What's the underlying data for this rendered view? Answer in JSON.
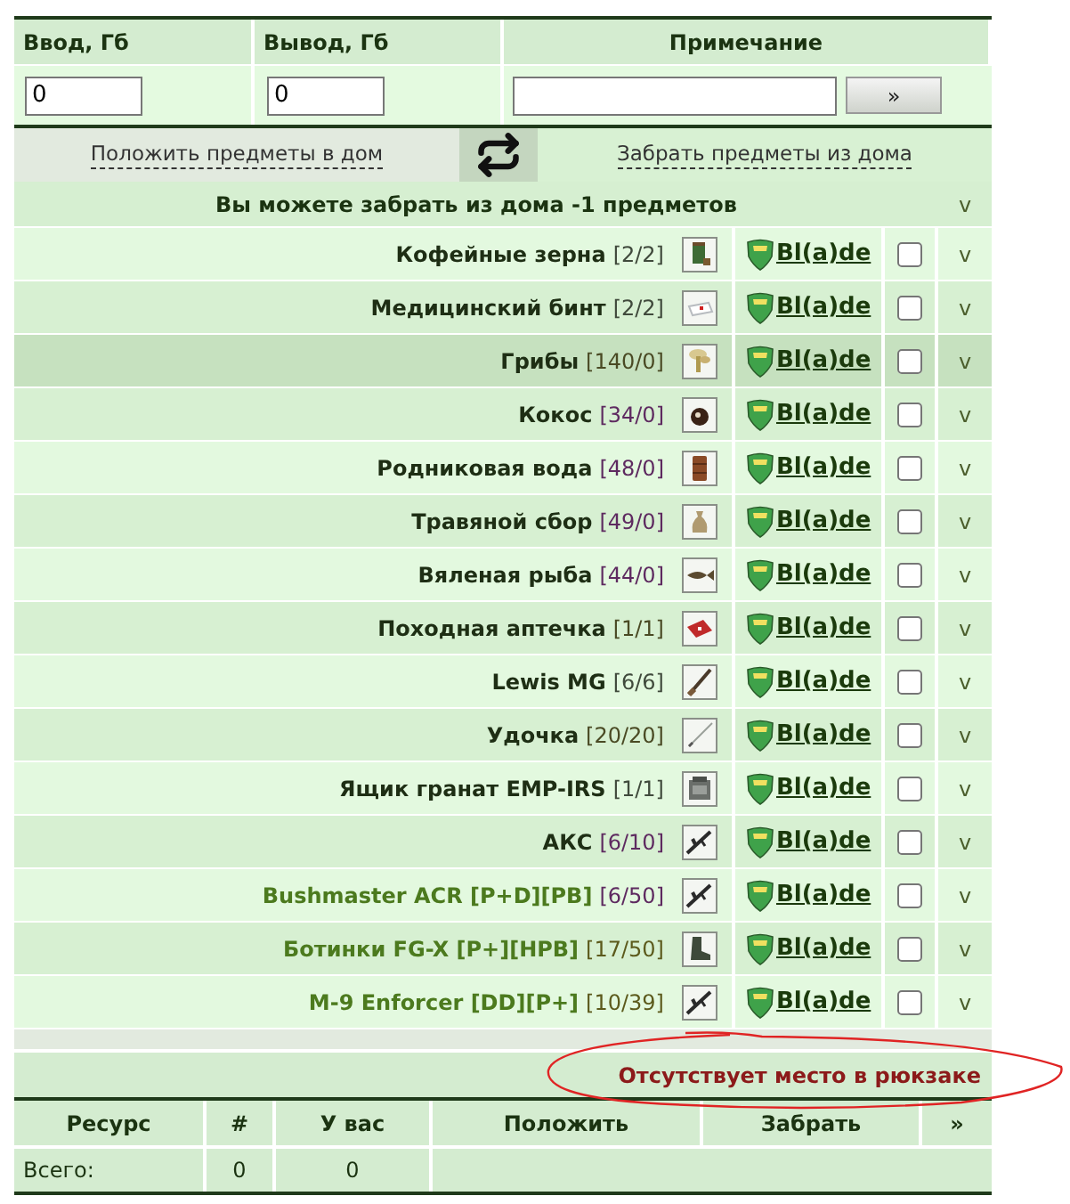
{
  "transfer_form": {
    "columns": [
      "Ввод, Гб",
      "Вывод, Гб",
      "Примечание"
    ],
    "input_value": "0",
    "output_value": "0",
    "submit_label": "»"
  },
  "mode_tabs": [
    {
      "label": "Положить предметы в дом",
      "selected": false
    },
    {
      "label": "Забрать предметы из дома",
      "selected": true
    }
  ],
  "items_header": {
    "title": "Вы можете забрать из дома -1 предметов",
    "toggle": "v"
  },
  "items": [
    {
      "name": {
        "text": "Кофейные зерна",
        "color": "#1e2e14"
      },
      "count": {
        "text": "[2/2]",
        "color": "#404a3c"
      },
      "kind": "jar",
      "owner": "Bl(a)de",
      "checked": false,
      "highlighted": false,
      "toggle": "v"
    },
    {
      "name": {
        "text": "Медицинский бинт",
        "color": "#1e2e14"
      },
      "count": {
        "text": "[2/2]",
        "color": "#404a3c"
      },
      "kind": "bandage",
      "owner": "Bl(a)de",
      "checked": false,
      "highlighted": false,
      "toggle": "v"
    },
    {
      "name": {
        "text": "Грибы",
        "color": "#1e2e14"
      },
      "count": {
        "text": "[140/0]",
        "color": "#4a4a24"
      },
      "kind": "mushroom",
      "owner": "Bl(a)de",
      "checked": false,
      "highlighted": true,
      "toggle": "v"
    },
    {
      "name": {
        "text": "Кокос",
        "color": "#1e2e14"
      },
      "count": {
        "text": "[34/0]",
        "color": "#5e2a60"
      },
      "kind": "coconut",
      "owner": "Bl(a)de",
      "checked": false,
      "highlighted": false,
      "toggle": "v"
    },
    {
      "name": {
        "text": "Родниковая вода",
        "color": "#1e2e14"
      },
      "count": {
        "text": "[48/0]",
        "color": "#5e2a60"
      },
      "kind": "barrel",
      "owner": "Bl(a)de",
      "checked": false,
      "highlighted": false,
      "toggle": "v"
    },
    {
      "name": {
        "text": "Травяной сбор",
        "color": "#1e2e14"
      },
      "count": {
        "text": "[49/0]",
        "color": "#5e2a60"
      },
      "kind": "sack",
      "owner": "Bl(a)de",
      "checked": false,
      "highlighted": false,
      "toggle": "v"
    },
    {
      "name": {
        "text": "Вяленая рыба",
        "color": "#1e2e14"
      },
      "count": {
        "text": "[44/0]",
        "color": "#5e2a60"
      },
      "kind": "fish",
      "owner": "Bl(a)de",
      "checked": false,
      "highlighted": false,
      "toggle": "v"
    },
    {
      "name": {
        "text": "Походная аптечка",
        "color": "#1e2e14"
      },
      "count": {
        "text": "[1/1]",
        "color": "#4a4a24"
      },
      "kind": "medkit",
      "owner": "Bl(a)de",
      "checked": false,
      "highlighted": false,
      "toggle": "v"
    },
    {
      "name": {
        "text": "Lewis MG",
        "color": "#1e2e14"
      },
      "count": {
        "text": "[6/6]",
        "color": "#404a3c"
      },
      "kind": "rifle",
      "owner": "Bl(a)de",
      "checked": false,
      "highlighted": false,
      "toggle": "v"
    },
    {
      "name": {
        "text": "Удочка",
        "color": "#1e2e14"
      },
      "count": {
        "text": "[20/20]",
        "color": "#4a4a24"
      },
      "kind": "rod",
      "owner": "Bl(a)de",
      "checked": false,
      "highlighted": false,
      "toggle": "v"
    },
    {
      "name": {
        "text": "Ящик гранат EMP-IRS",
        "color": "#1e2e14"
      },
      "count": {
        "text": "[1/1]",
        "color": "#404a3c"
      },
      "kind": "case",
      "owner": "Bl(a)de",
      "checked": false,
      "highlighted": false,
      "toggle": "v"
    },
    {
      "name": {
        "text": "АКС",
        "color": "#1e2e14"
      },
      "count": {
        "text": "[6/10]",
        "color": "#5e2a60"
      },
      "kind": "gun",
      "owner": "Bl(a)de",
      "checked": false,
      "highlighted": false,
      "toggle": "v"
    },
    {
      "name": {
        "text": "Bushmaster ACR [P+D][PB]",
        "color": "#4c7a1e"
      },
      "count": {
        "text": "[6/50]",
        "color": "#5e2a60"
      },
      "kind": "gun",
      "owner": "Bl(a)de",
      "checked": false,
      "highlighted": false,
      "toggle": "v"
    },
    {
      "name": {
        "text": "Ботинки FG-X [P+][HPB]",
        "color": "#4c7a1e"
      },
      "count": {
        "text": "[17/50]",
        "color": "#5c5a1c"
      },
      "kind": "boot",
      "owner": "Bl(a)de",
      "checked": false,
      "highlighted": false,
      "toggle": "v"
    },
    {
      "name": {
        "text": "M-9 Enforcer [DD][P+]",
        "color": "#4c7a1e"
      },
      "count": {
        "text": "[10/39]",
        "color": "#5c5a1c"
      },
      "kind": "gun",
      "owner": "Bl(a)de",
      "checked": false,
      "highlighted": false,
      "toggle": "v"
    }
  ],
  "warning": "Отсутствует место в рюкзаке",
  "resources": {
    "columns": [
      "Ресурс",
      "#",
      "У вас",
      "Положить",
      "Забрать",
      "»"
    ],
    "rows": [
      {
        "cells": [
          "Всего:",
          "0",
          "0"
        ]
      }
    ]
  }
}
